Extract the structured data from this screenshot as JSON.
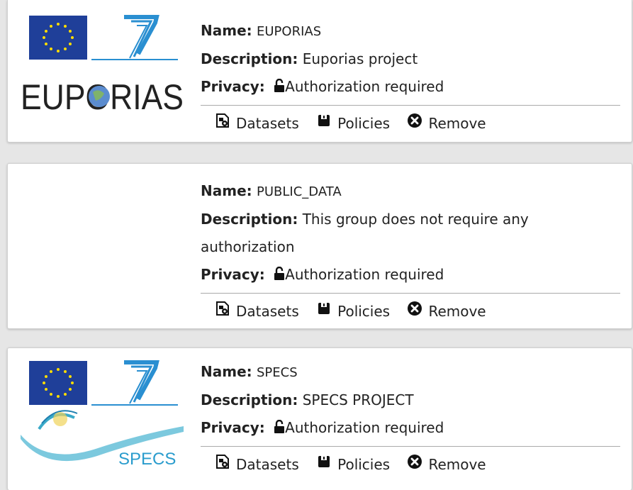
{
  "labels": {
    "name": "Name:",
    "description": "Description:",
    "privacy": "Privacy:"
  },
  "actions": {
    "datasets": "Datasets",
    "policies": "Policies",
    "remove": "Remove"
  },
  "groups": [
    {
      "name": "EUPORIAS",
      "description": "Euporias project",
      "privacy": "Authorization required",
      "logo_text": "EUPORIAS",
      "logo_icon": "euporias-logo"
    },
    {
      "name": "PUBLIC_DATA",
      "description": "This group does not require any authorization",
      "privacy": "Authorization required",
      "logo_icon": ""
    },
    {
      "name": "SPECS",
      "description": "SPECS PROJECT",
      "privacy": "Authorization required",
      "logo_text": "SPECS",
      "logo_icon": "specs-logo"
    }
  ],
  "colors": {
    "eu_blue": "#1f3f99",
    "eu_star": "#ffdd00",
    "fp7_blue": "#2a8fd1",
    "specs_teal": "#3aa9c8"
  }
}
